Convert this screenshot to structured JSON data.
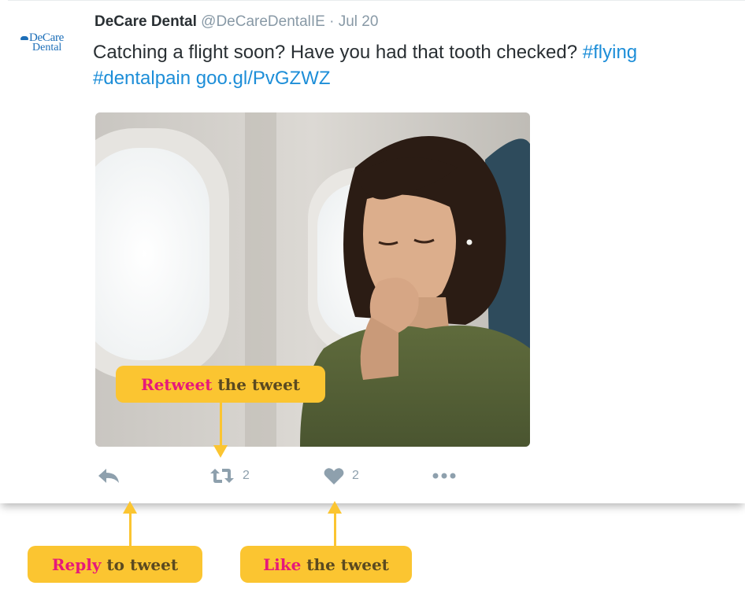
{
  "colors": {
    "link": "#1d8ed8",
    "icon_gray": "#8ea0ad",
    "callout_bg": "#fbc531",
    "callout_highlight": "#e6197a",
    "brand_blue": "#1c6eb8"
  },
  "tweet": {
    "logo": {
      "line1": "DeCare",
      "line2": "Dental"
    },
    "author_name": "DeCare Dental",
    "handle": "@DeCareDentalIE",
    "separator": "·",
    "date": "Jul 20",
    "text_plain": "Catching a flight soon? Have you had that tooth checked?",
    "hashtag1": "#flying",
    "hashtag2": "#dentalpain",
    "short_link": "goo.gl/PvGZWZ",
    "photo_icon": "photo-airplane-passenger"
  },
  "actions": {
    "reply_icon": "reply-icon",
    "retweet_icon": "retweet-icon",
    "retweet_count": "2",
    "like_icon": "heart-icon",
    "like_count": "2",
    "more_icon": "more-dots-icon"
  },
  "callouts": {
    "retweet": {
      "highlight": "Retweet",
      "rest": " the tweet"
    },
    "reply": {
      "highlight": "Reply",
      "rest": " to tweet"
    },
    "like": {
      "highlight": "Like",
      "rest": " the tweet"
    }
  }
}
